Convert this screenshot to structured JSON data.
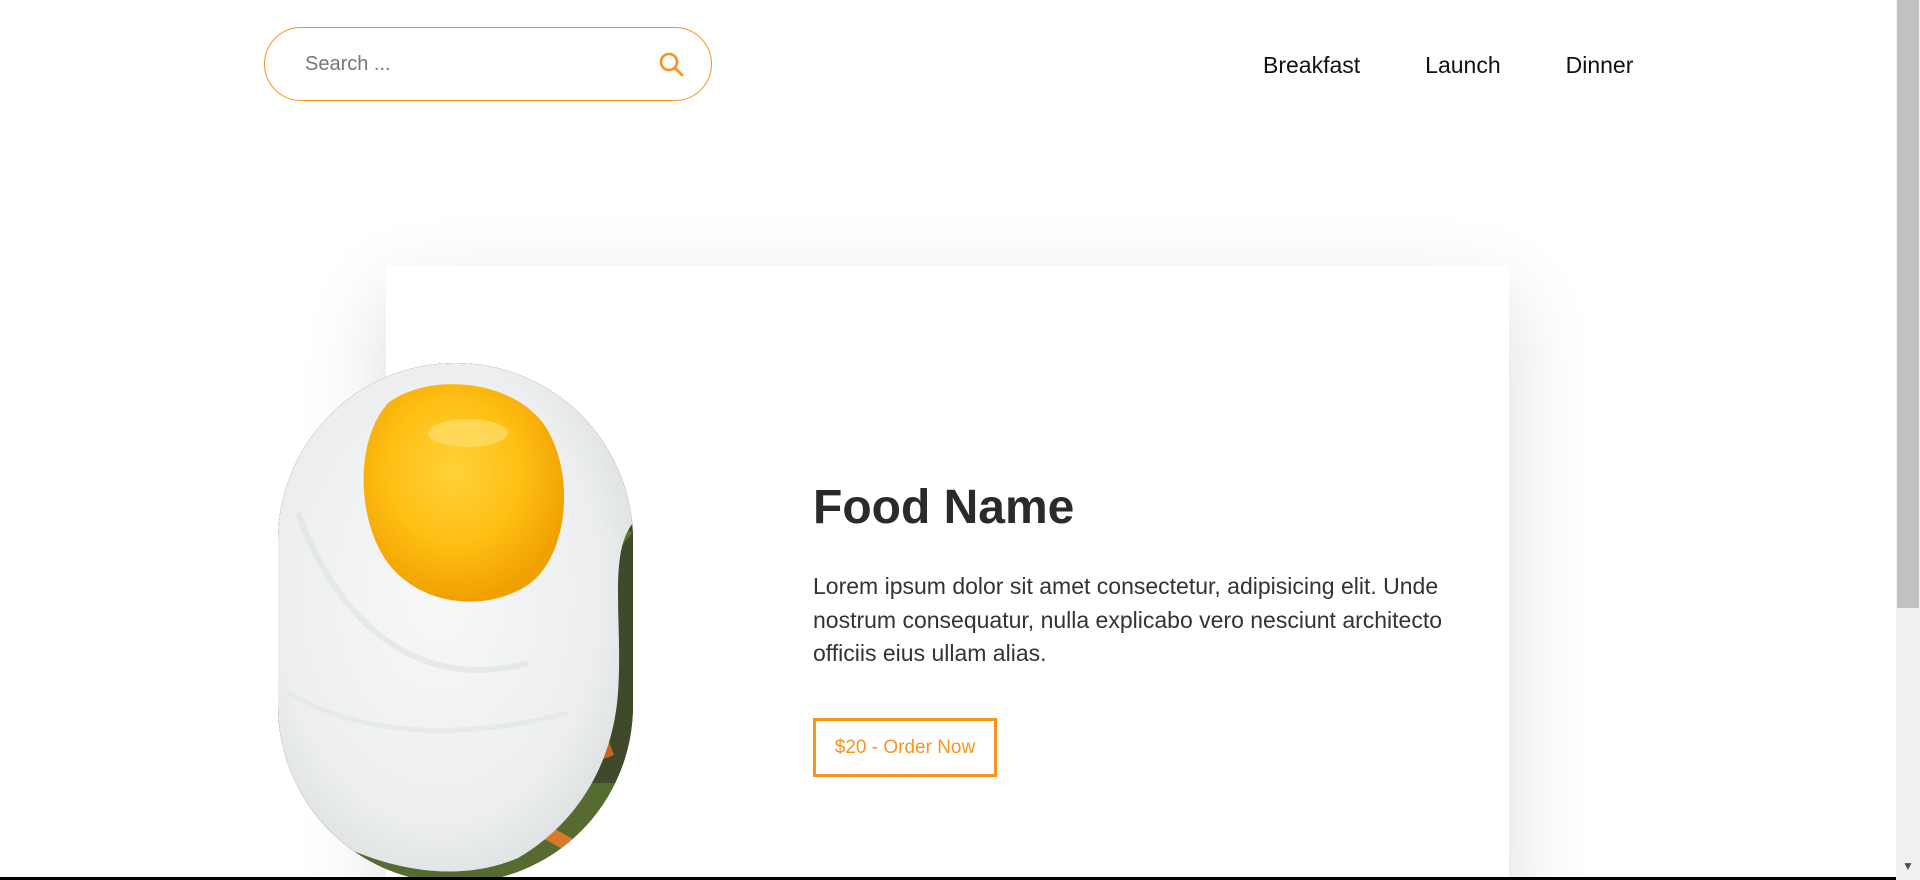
{
  "header": {
    "search": {
      "placeholder": "Search ...",
      "value": "",
      "icon": "search-icon"
    },
    "nav": [
      {
        "label": "Breakfast"
      },
      {
        "label": "Launch"
      },
      {
        "label": "Dinner"
      }
    ]
  },
  "card": {
    "image": "fried-egg-photo",
    "title": "Food Name",
    "description": "Lorem ipsum dolor sit amet consectetur, adipisicing elit. Unde nostrum consequatur, nulla explicabo vero nesciunt architecto officiis eius ullam alias.",
    "button_label": "$20 - Order Now"
  },
  "colors": {
    "accent": "#f7941d",
    "text": "#2a2a2a",
    "background": "#ffffff"
  }
}
